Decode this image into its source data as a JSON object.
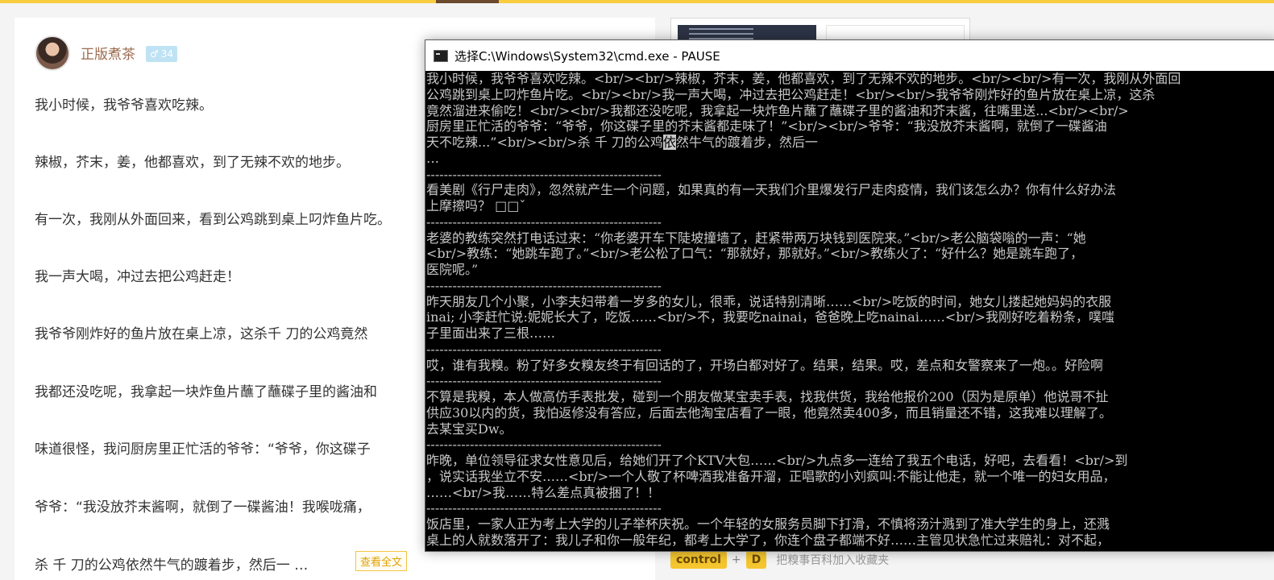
{
  "article": {
    "author": "正版煮茶",
    "badge_icon": "male-icon",
    "badge_symbol": "♂",
    "badge_count": "34",
    "paragraphs": [
      "我小时候，我爷爷喜欢吃辣。",
      "辣椒，芥末，姜，他都喜欢，到了无辣不欢的地步。",
      "有一次，我刚从外面回来，看到公鸡跳到桌上叼炸鱼片吃。",
      "我一声大喝，冲过去把公鸡赶走！",
      "我爷爷刚炸好的鱼片放在桌上凉，这杀千 刀的公鸡竟然",
      "我都还没吃呢，我拿起一块炸鱼片蘸了蘸碟子里的酱油和",
      "味道很怪，我问厨房里正忙活的爷爷：“爷爷，你这碟子",
      "爷爷：“我没放芥末酱啊，就倒了一碟酱油！我喉咙痛，",
      "杀 千 刀的公鸡依然牛气的踱着步，然后一 …"
    ],
    "read_more": "查看全文"
  },
  "sidebar": {
    "shortcut_key1": "control",
    "shortcut_plus": "+",
    "shortcut_key2": "D",
    "shortcut_text": "把糗事百科加入收藏夹"
  },
  "cmd": {
    "title": "选择C:\\Windows\\System32\\cmd.exe - PAUSE",
    "lines": [
      "我小时候，我爷爷喜欢吃辣。<br/><br/>辣椒，芥末，姜，他都喜欢，到了无辣不欢的地步。<br/><br/>有一次，我刚从外面回",
      "公鸡跳到桌上叼炸鱼片吃。<br/><br/>我一声大喝，冲过去把公鸡赶走！<br/><br/>我爷爷刚炸好的鱼片放在桌上凉，这杀",
      "竟然溜进来偷吃！<br/><br/>我都还没吃呢，我拿起一块炸鱼片蘸了蘸碟子里的酱油和芥末酱，往嘴里送...<br/><br/>",
      "厨房里正忙活的爷爷：“爷爷，你这碟子里的芥末酱都走味了！”<br/><br/>爷爷：“我没放芥末酱啊，就倒了一碟酱油",
      "天不吃辣...”<br/><br/>杀 千 刀的公鸡",
      "…",
      "------------------------------------------------------",
      "看美剧《行尸走肉》，忽然就产生一个问题，如果真的有一天我们介里爆发行尸走肉疫情，我们该怎么办？你有什么好办法",
      "上摩擦吗？ □□ˇ",
      "------------------------------------------------------",
      "老婆的教练突然打电话过来：“你老婆开车下陡坡撞墙了，赶紧带两万块钱到医院来。”<br/>老公脑袋嗡的一声：“她",
      "<br/>教练：“她跳车跑了。”<br/>老公松了口气：“那就好，那就好。”<br/>教练火了：“好什么？她是跳车跑了，",
      "医院呢。”",
      "------------------------------------------------------",
      "昨天朋友几个小聚，小李夫妇带着一岁多的女儿，很乖，说话特别清晰……<br/>吃饭的时间，她女儿搂起她妈妈的衣服",
      "inai; 小李赶忙说:妮妮长大了，吃饭……<br/>不，我要吃nainai，爸爸晚上吃nainai……<br/>我刚好吃着粉条，噗嗤",
      "子里面出来了三根……",
      "------------------------------------------------------",
      "哎，谁有我糗。粉了好多女糗友终于有回话的了，开场白都对好了。结果，结果。哎，差点和女警察来了一炮。。好险啊",
      "------------------------------------------------------",
      "不算是我糗，本人做高仿手表批发，碰到一个朋友做某宝卖手表，找我供货，我给他报价200（因为是原单）他说哥不扯",
      "供应30以内的货，我怕返修没有答应，后面去他淘宝店看了一眼，他竟然卖400多，而且销量还不错，这我难以理解了。",
      "去某宝买Dw。",
      "------------------------------------------------------",
      "昨晚，单位领导征求女性意见后，给她们开了个KTV大包……<br/>九点多一连给了我五个电话，好吧，去看看！<br/>到",
      "，说实话我坐立不安……<br/>一个人敬了杯啤酒我准备开溜，正唱歌的小刘疯叫:不能让他走，就一个唯一的妇女用品，",
      "……<br/>我……特么差点真被捆了！！",
      "------------------------------------------------------",
      "饭店里，一家人正为考上大学的儿子举杯庆祝。一个年轻的女服务员脚下打滑，不慎将汤汁溅到了准大学生的身上，还溅",
      "桌上的人就数落开了：我儿子和你一般年纪，都考上大学了，你连个盘子都端不好……主管见状急忙过来赔礼：对不起，"
    ],
    "line5_highlight": "依",
    "line5_tail": "然牛气的踱着步，然后一"
  }
}
